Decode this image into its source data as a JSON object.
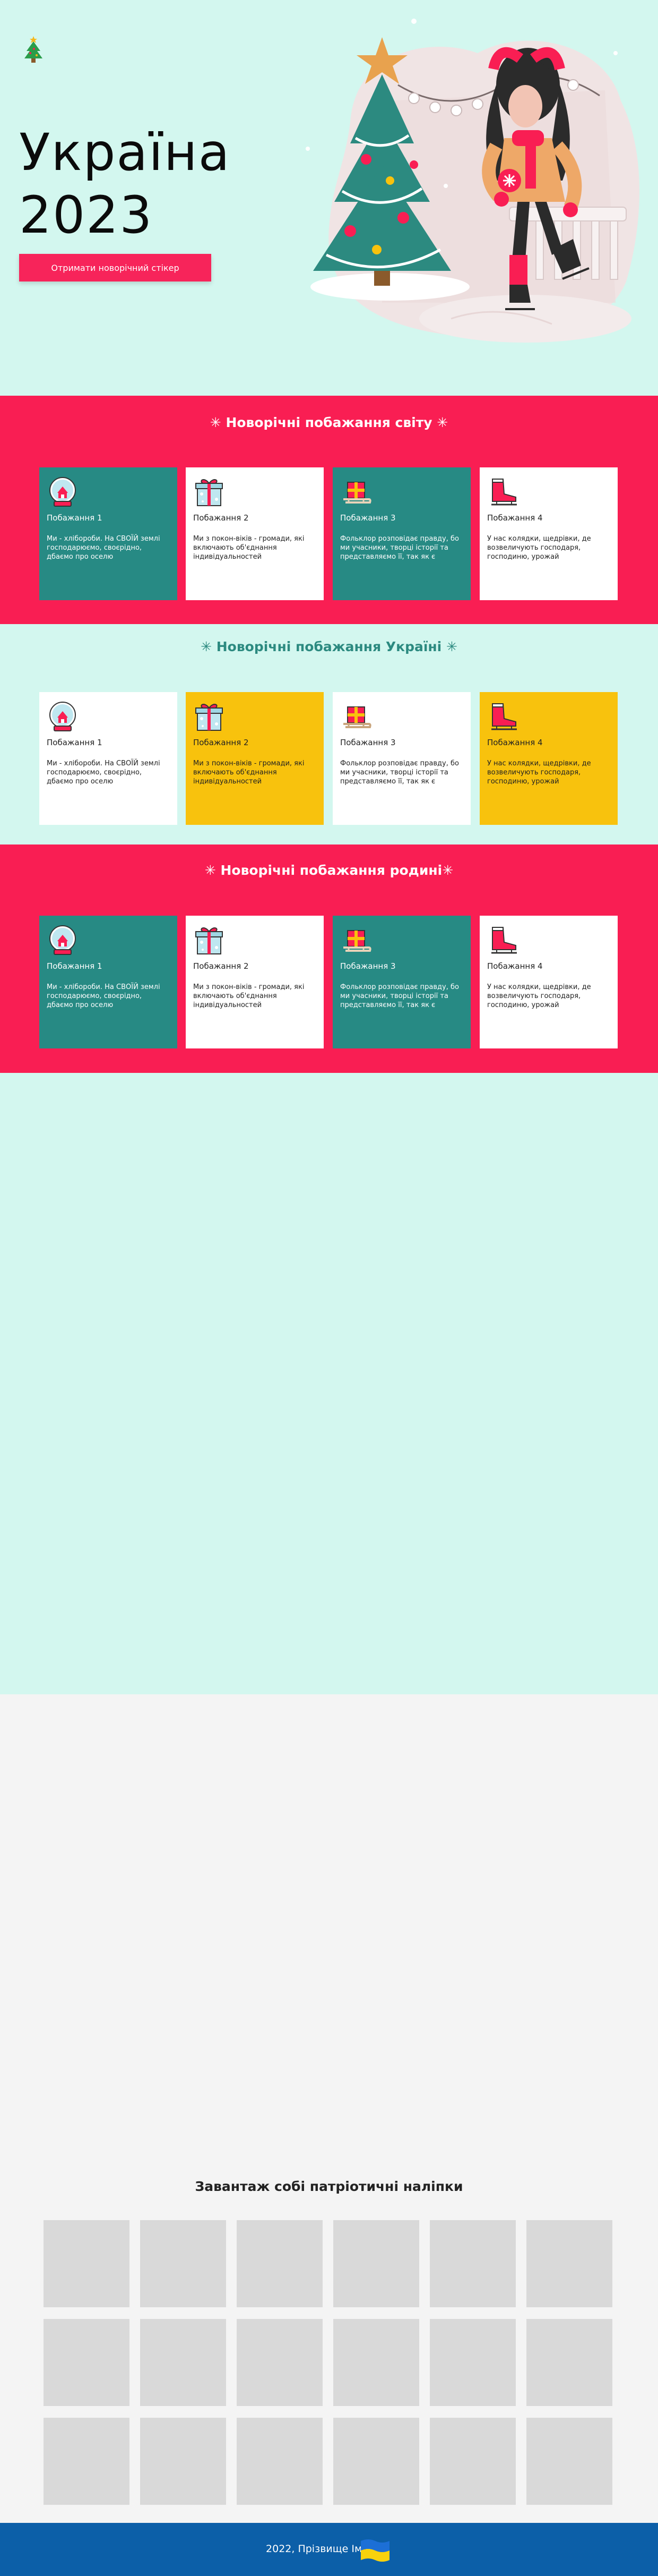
{
  "hero": {
    "logo_icon": "christmas-tree-icon",
    "title_line1": "Україна",
    "title_line2": "2023",
    "button_label": "Отримати новорічний стікер",
    "colors": {
      "background": "#d3f7ef",
      "accent": "#f7245a"
    }
  },
  "sections": [
    {
      "title": "✳ Новорічні побажання світу ✳",
      "cards": [
        {
          "icon": "snow-globe-icon",
          "title": "Побажання 1",
          "text": "Ми - хлібороби. На СВОЇЙ землі господарюємо, своєрідно, дбаємо про оселю"
        },
        {
          "icon": "gift-box-icon",
          "title": "Побажання 2",
          "text": "Ми з покон-віків - громади, які включають об'єднання індивідуальностей"
        },
        {
          "icon": "sled-gift-icon",
          "title": "Побажання 3",
          "text": "Фольклор розповідає правду, бо ми учасники, творці історії та представляємо її, так як є"
        },
        {
          "icon": "ice-skate-icon",
          "title": "Побажання 4",
          "text": "У нас колядки, щедрівки, де возвеличують господаря, господиню, урожай"
        }
      ]
    },
    {
      "title": "✳ Новорічні побажання Україні ✳",
      "cards": [
        {
          "icon": "snow-globe-icon",
          "title": "Побажання 1",
          "text": "Ми - хлібороби. На СВОЇЙ землі господарюємо, своєрідно, дбаємо про оселю"
        },
        {
          "icon": "gift-box-icon",
          "title": "Побажання 2",
          "text": "Ми з покон-віків - громади, які включають об'єднання індивідуальностей"
        },
        {
          "icon": "sled-gift-icon",
          "title": "Побажання 3",
          "text": "Фольклор розповідає правду, бо ми учасники, творці історії та представляємо її, так як є"
        },
        {
          "icon": "ice-skate-icon",
          "title": "Побажання 4",
          "text": "У нас колядки, щедрівки, де возвеличують господаря, господиню, урожай"
        }
      ]
    },
    {
      "title": "✳ Новорічні побажання родині✳",
      "cards": [
        {
          "icon": "snow-globe-icon",
          "title": "Побажання 1",
          "text": "Ми - хлібороби. На СВОЇЙ землі господарюємо, своєрідно, дбаємо про оселю"
        },
        {
          "icon": "gift-box-icon",
          "title": "Побажання 2",
          "text": "Ми з покон-віків - громади, які включають об'єднання індивідуальностей"
        },
        {
          "icon": "sled-gift-icon",
          "title": "Побажання 3",
          "text": "Фольклор розповідає правду, бо ми учасники, творці історії та представляємо її, так як є"
        },
        {
          "icon": "ice-skate-icon",
          "title": "Побажання 4",
          "text": "У нас колядки, щедрівки, де возвеличують господаря, господиню, урожай"
        }
      ]
    }
  ],
  "stickers": {
    "title": "Завантаж собі патріотичні наліпки"
  },
  "footer": {
    "text": "2022, Прізвище Ім'я",
    "flag_icon": "ukraine-flag-icon",
    "colors": {
      "background": "#0c5fa8",
      "flag_blue": "#1c6fd6",
      "flag_yellow": "#f8d20d"
    }
  },
  "colors": {
    "red": "#f91e53",
    "teal": "#278a84",
    "yellow": "#f8c20d",
    "mint": "#d3f7ef",
    "sticker_placeholder": "#d9d9d9"
  }
}
